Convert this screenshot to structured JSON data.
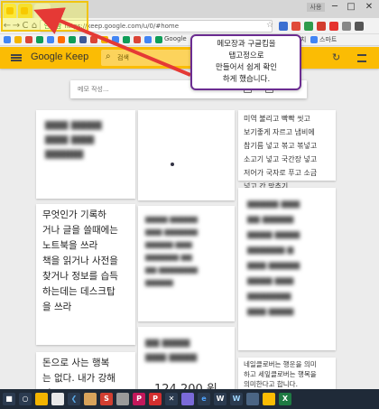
{
  "browser": {
    "profile_label": "사용",
    "window_controls": [
      "─",
      "□",
      "✕"
    ],
    "nav": [
      "←",
      "→",
      "C",
      "⌂"
    ],
    "secure_label": "안전함",
    "url": "https://keep.google.com/u/0/#home",
    "bookmark_labels": [
      "Google",
      "글리치",
      "스마트"
    ]
  },
  "keep": {
    "app_name": "Google Keep",
    "search_placeholder": "검색",
    "take_note_placeholder": "메모 작성..."
  },
  "notes": {
    "n1": "무엇인가 기록하\n거나 글을 쓸때에는\n노트북을 쓰라\n책을 읽거나 사전을\n찾거나 정보를 습득\n하는데는 데스크탑\n을 쓰라",
    "n2": "돈으로 사는 행복\n는 없다. 내가 강해\n지",
    "n3": "미역 불리고 빡빡 씻고\n보기좋게 자르고 냄비에\n참기름 넣고 볶고 볶넣고\n소고기 넣고 국간장 넣고\n저어가 국자로 푸고 소금\n넣고 간 맞추기",
    "n4": "네일클로버는 행운을 의미\n하고 세잎클로버는 행복을\n의미한다고 합니다.",
    "n5": "124,200 원"
  },
  "callout": {
    "text": "메모장과 구글킵을\n탭고정으로\n만들어서 쉽게 확인\n하게 했습니다."
  },
  "colors": {
    "keep_yellow": "#fbbc04",
    "callout_border": "#6b2c91",
    "arrow_red": "#e53935",
    "highlight_yellow": "#f1c40f"
  }
}
